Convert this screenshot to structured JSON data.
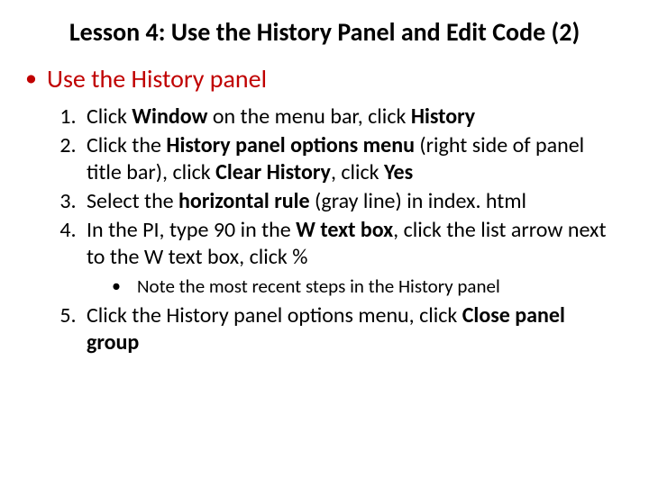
{
  "title": "Lesson 4: Use the History Panel and Edit Code (2)",
  "lead": "Use the History panel",
  "steps": {
    "s1": {
      "a": "Click ",
      "b1": "Window",
      "c": " on the menu bar, click ",
      "b2": "History"
    },
    "s2": {
      "a": "Click the ",
      "b1": "History panel options menu",
      "c": " (right side of panel title bar), click ",
      "b2": "Clear History",
      "d": ", click ",
      "b3": "Yes"
    },
    "s3": {
      "a": "Select the ",
      "b1": "horizontal rule",
      "c": " (gray line) in index. html"
    },
    "s4": {
      "a": "In the PI, type 90 in the ",
      "b1": "W text box",
      "c": ", click the list arrow next to the W text box, click %"
    },
    "note": "Note the most recent steps in the History panel",
    "s5": {
      "a": "Click the History panel options menu, click ",
      "b1": "Close panel group"
    }
  }
}
